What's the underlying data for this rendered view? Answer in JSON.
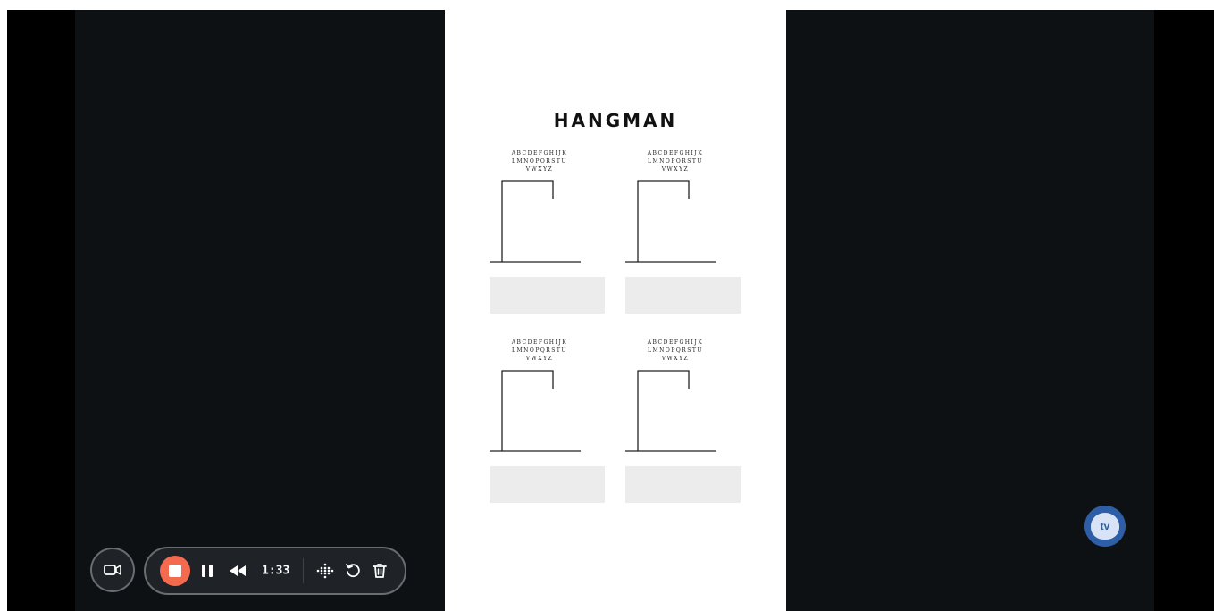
{
  "document": {
    "title": "HANGMAN",
    "alphabet_lines": [
      "ABCDEFGHIJK",
      "LMNOPQRSTU",
      "VWXYZ"
    ],
    "panel_count": 4
  },
  "recorder": {
    "timer": "1:33",
    "buttons": [
      "camera",
      "stop",
      "pause",
      "rewind",
      "grid",
      "restart",
      "delete"
    ],
    "accent_color": "#f46a4e"
  },
  "assistant": {
    "label": "tv"
  },
  "colors": {
    "video_bg": "#0e1114",
    "toolbar_bg": "#1f2327",
    "assistant_bg": "#2d5ea6"
  }
}
